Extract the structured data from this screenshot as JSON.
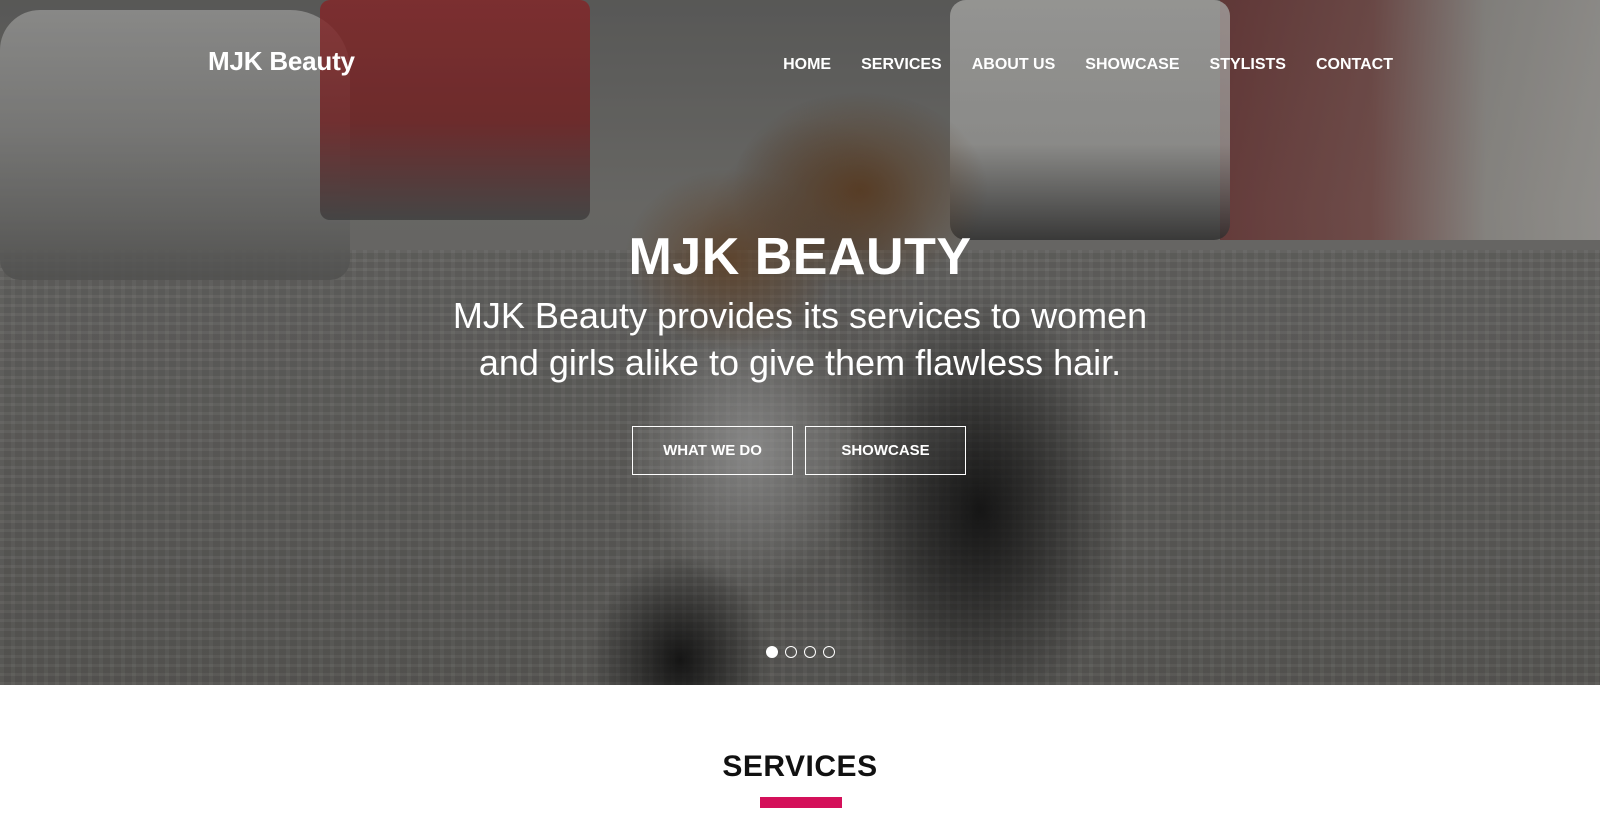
{
  "brand": {
    "name": "MJK Beauty"
  },
  "nav": {
    "items": [
      {
        "label": "HOME"
      },
      {
        "label": "SERVICES"
      },
      {
        "label": "ABOUT US"
      },
      {
        "label": "SHOWCASE"
      },
      {
        "label": "STYLISTS"
      },
      {
        "label": "CONTACT"
      }
    ]
  },
  "hero": {
    "title": "MJK BEAUTY",
    "subtitle": "MJK Beauty provides its services to women and girls alike to give them flawless hair.",
    "buttons": [
      {
        "label": "WHAT WE DO"
      },
      {
        "label": "SHOWCASE"
      }
    ],
    "carousel": {
      "slide_count": 4,
      "active_slide": 1
    }
  },
  "services": {
    "title": "SERVICES",
    "accent_color": "#d4105a"
  },
  "colors": {
    "nav_text": "#ffffff",
    "accent": "#d4105a"
  }
}
